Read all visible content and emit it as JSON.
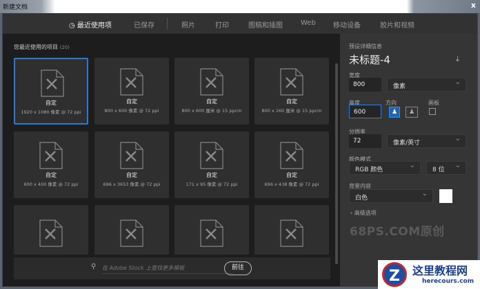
{
  "window": {
    "title": "新建文档",
    "close": "x"
  },
  "tabs": [
    {
      "label": "最近使用项"
    },
    {
      "label": "已保存"
    },
    {
      "label": "照片"
    },
    {
      "label": "打印"
    },
    {
      "label": "图稿和插图"
    },
    {
      "label": "Web"
    },
    {
      "label": "移动设备"
    },
    {
      "label": "胶片和视频"
    }
  ],
  "recent": {
    "heading": "您最近使用的项目",
    "count": "(20)",
    "items": [
      {
        "name": "自定",
        "desc": "1920 x 1080 像素 @ 72 ppi"
      },
      {
        "name": "自定",
        "desc": "800 x 600 像素 @ 72 ppi"
      },
      {
        "name": "自定",
        "desc": "800 x 600 厘米 @ 15 ppcm"
      },
      {
        "name": "自定",
        "desc": "800 x 160 厘米 @ 15 ppcm"
      },
      {
        "name": "自定",
        "desc": "600 x 400 像素 @ 72 ppi"
      },
      {
        "name": "自定",
        "desc": "696 x 3653 像素 @ 72 ppi"
      },
      {
        "name": "自定",
        "desc": "171 x 95 像素 @ 72 ppi"
      },
      {
        "name": "自定",
        "desc": "696 x 438 像素 @ 72 ppi"
      }
    ]
  },
  "stock": {
    "placeholder": "在 Adobe Stock 上查找更多模板",
    "go": "前往"
  },
  "details": {
    "section": "预设详细信息",
    "doc_title": "未标题-4",
    "width_label": "宽度",
    "width": "800",
    "width_unit": "像素",
    "height_label": "高度",
    "height": "600",
    "orientation_label": "方向",
    "artboard_label": "画板",
    "resolution_label": "分辨率",
    "resolution": "72",
    "resolution_unit": "像素/英寸",
    "color_mode_label": "颜色模式",
    "color_mode": "RGB 颜色",
    "bit_depth": "8 位",
    "background_label": "背景内容",
    "background": "白色",
    "background_color": "#ffffff",
    "advanced": "高级选项"
  },
  "watermark": "68PS.COM原创",
  "logo": {
    "title": "这里教程网",
    "url": "herecours.com"
  }
}
